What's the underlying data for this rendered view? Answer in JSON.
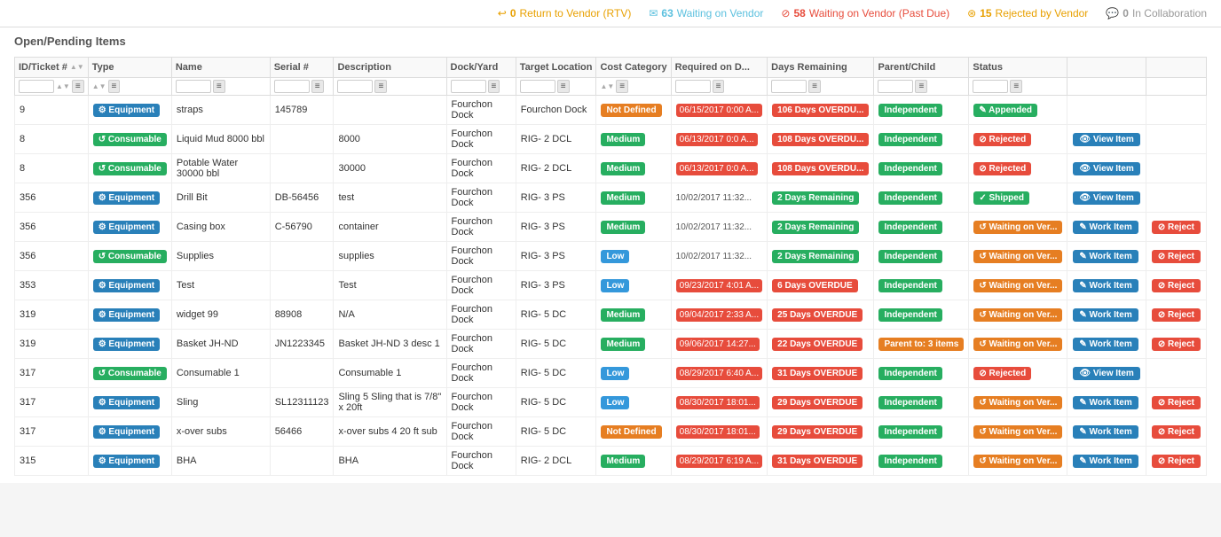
{
  "topbar": {
    "rtv_count": "0",
    "rtv_label": "Return to Vendor (RTV)",
    "waiting_count": "63",
    "waiting_label": "Waiting on Vendor",
    "pastdue_count": "58",
    "pastdue_label": "Waiting on Vendor (Past Due)",
    "rejected_count": "15",
    "rejected_label": "Rejected by Vendor",
    "collab_count": "0",
    "collab_label": "In Collaboration"
  },
  "section_title": "Open/Pending Items",
  "columns": [
    "ID/Ticket #",
    "Type",
    "Name",
    "Serial #",
    "Description",
    "Dock/Yard",
    "Target Location",
    "Cost Category",
    "Required on D...",
    "Days Remaining",
    "Parent/Child",
    "Status"
  ],
  "rows": [
    {
      "id": "9",
      "type": "Equipment",
      "type_class": "equipment",
      "name": "straps",
      "serial": "145789",
      "description": "",
      "dock": "Fourchon Dock",
      "target": "Fourchon Dock",
      "cost": "Not Defined",
      "cost_class": "not-defined",
      "required": "06/15/2017 0:00 A...",
      "required_class": "overdue",
      "days": "106 Days OVERDU...",
      "days_class": "overdue-days",
      "parent": "Independent",
      "parent_class": "independent",
      "status": "Appended",
      "status_class": "appended",
      "actions": []
    },
    {
      "id": "8",
      "type": "Consumable",
      "type_class": "consumable",
      "name": "Liquid Mud 8000 bbl",
      "serial": "",
      "description": "8000",
      "dock": "Fourchon Dock",
      "target": "RIG- 2 DCL",
      "cost": "Medium",
      "cost_class": "medium",
      "required": "06/13/2017 0:0 A...",
      "required_class": "overdue",
      "days": "108 Days OVERDU...",
      "days_class": "overdue-days",
      "parent": "Independent",
      "parent_class": "independent",
      "status": "Rejected",
      "status_class": "rejected",
      "actions": [
        "View Item"
      ]
    },
    {
      "id": "8",
      "type": "Consumable",
      "type_class": "consumable",
      "name": "Potable Water 30000 bbl",
      "serial": "",
      "description": "30000",
      "dock": "Fourchon Dock",
      "target": "RIG- 2 DCL",
      "cost": "Medium",
      "cost_class": "medium",
      "required": "06/13/2017 0:0 A...",
      "required_class": "overdue",
      "days": "108 Days OVERDU...",
      "days_class": "overdue-days",
      "parent": "Independent",
      "parent_class": "independent",
      "status": "Rejected",
      "status_class": "rejected",
      "actions": [
        "View Item"
      ]
    },
    {
      "id": "356",
      "type": "Equipment",
      "type_class": "equipment",
      "name": "Drill Bit",
      "serial": "DB-56456",
      "description": "test",
      "dock": "Fourchon Dock",
      "target": "RIG- 3 PS",
      "cost": "Medium",
      "cost_class": "medium",
      "required": "10/02/2017 11:32...",
      "required_class": "normal",
      "days": "2 Days Remaining",
      "days_class": "remaining",
      "parent": "Independent",
      "parent_class": "independent",
      "status": "Shipped",
      "status_class": "shipped",
      "actions": [
        "View Item"
      ]
    },
    {
      "id": "356",
      "type": "Equipment",
      "type_class": "equipment",
      "name": "Casing box",
      "serial": "C-56790",
      "description": "container",
      "dock": "Fourchon Dock",
      "target": "RIG- 3 PS",
      "cost": "Medium",
      "cost_class": "medium",
      "required": "10/02/2017 11:32...",
      "required_class": "normal",
      "days": "2 Days Remaining",
      "days_class": "remaining",
      "parent": "Independent",
      "parent_class": "independent",
      "status": "Waiting on Ver...",
      "status_class": "waiting",
      "actions": [
        "Work Item",
        "Reject"
      ]
    },
    {
      "id": "356",
      "type": "Consumable",
      "type_class": "consumable",
      "name": "Supplies",
      "serial": "",
      "description": "supplies",
      "dock": "Fourchon Dock",
      "target": "RIG- 3 PS",
      "cost": "Low",
      "cost_class": "low",
      "required": "10/02/2017 11:32...",
      "required_class": "normal",
      "days": "2 Days Remaining",
      "days_class": "remaining",
      "parent": "Independent",
      "parent_class": "independent",
      "status": "Waiting on Ver...",
      "status_class": "waiting",
      "actions": [
        "Work Item",
        "Reject"
      ]
    },
    {
      "id": "353",
      "type": "Equipment",
      "type_class": "equipment",
      "name": "Test",
      "serial": "",
      "description": "Test",
      "dock": "Fourchon Dock",
      "target": "RIG- 3 PS",
      "cost": "Low",
      "cost_class": "low",
      "required": "09/23/2017 4:01 A...",
      "required_class": "overdue",
      "days": "6 Days OVERDUE",
      "days_class": "overdue-days",
      "parent": "Independent",
      "parent_class": "independent",
      "status": "Waiting on Ver...",
      "status_class": "waiting",
      "actions": [
        "Work Item",
        "Reject"
      ]
    },
    {
      "id": "319",
      "type": "Equipment",
      "type_class": "equipment",
      "name": "widget 99",
      "serial": "88908",
      "description": "N/A",
      "dock": "Fourchon Dock",
      "target": "RIG- 5 DC",
      "cost": "Medium",
      "cost_class": "medium",
      "required": "09/04/2017 2:33 A...",
      "required_class": "overdue",
      "days": "25 Days OVERDUE",
      "days_class": "overdue-days",
      "parent": "Independent",
      "parent_class": "independent",
      "status": "Waiting on Ver...",
      "status_class": "waiting",
      "actions": [
        "Work Item",
        "Reject"
      ]
    },
    {
      "id": "319",
      "type": "Equipment",
      "type_class": "equipment",
      "name": "Basket JH-ND",
      "serial": "JN1223345",
      "description": "Basket JH-ND 3 desc 1",
      "dock": "Fourchon Dock",
      "target": "RIG- 5 DC",
      "cost": "Medium",
      "cost_class": "medium",
      "required": "09/06/2017 14:27...",
      "required_class": "overdue",
      "days": "22 Days OVERDUE",
      "days_class": "overdue-days",
      "parent": "Parent to: 3 items",
      "parent_class": "parent",
      "status": "Waiting on Ver...",
      "status_class": "waiting",
      "actions": [
        "Work Item",
        "Reject"
      ]
    },
    {
      "id": "317",
      "type": "Consumable",
      "type_class": "consumable",
      "name": "Consumable 1",
      "serial": "",
      "description": "Consumable 1",
      "dock": "Fourchon Dock",
      "target": "RIG- 5 DC",
      "cost": "Low",
      "cost_class": "low",
      "required": "08/29/2017 6:40 A...",
      "required_class": "overdue",
      "days": "31 Days OVERDUE",
      "days_class": "overdue-days",
      "parent": "Independent",
      "parent_class": "independent",
      "status": "Rejected",
      "status_class": "rejected",
      "actions": [
        "View Item"
      ]
    },
    {
      "id": "317",
      "type": "Equipment",
      "type_class": "equipment",
      "name": "Sling",
      "serial": "SL12311123",
      "description": "Sling 5 Sling that is 7/8\" x 20ft",
      "dock": "Fourchon Dock",
      "target": "RIG- 5 DC",
      "cost": "Low",
      "cost_class": "low",
      "required": "08/30/2017 18:01...",
      "required_class": "overdue",
      "days": "29 Days OVERDUE",
      "days_class": "overdue-days",
      "parent": "Independent",
      "parent_class": "independent",
      "status": "Waiting on Ver...",
      "status_class": "waiting",
      "actions": [
        "Work Item",
        "Reject"
      ]
    },
    {
      "id": "317",
      "type": "Equipment",
      "type_class": "equipment",
      "name": "x-over subs",
      "serial": "56466",
      "description": "x-over subs 4 20 ft sub",
      "dock": "Fourchon Dock",
      "target": "RIG- 5 DC",
      "cost": "Not Defined",
      "cost_class": "not-defined",
      "required": "08/30/2017 18:01...",
      "required_class": "overdue",
      "days": "29 Days OVERDUE",
      "days_class": "overdue-days",
      "parent": "Independent",
      "parent_class": "independent",
      "status": "Waiting on Ver...",
      "status_class": "waiting",
      "actions": [
        "Work Item",
        "Reject"
      ]
    },
    {
      "id": "315",
      "type": "Equipment",
      "type_class": "equipment",
      "name": "BHA",
      "serial": "",
      "description": "BHA",
      "dock": "Fourchon Dock",
      "target": "RIG- 2 DCL",
      "cost": "Medium",
      "cost_class": "medium",
      "required": "08/29/2017 6:19 A...",
      "required_class": "overdue",
      "days": "31 Days OVERDUE",
      "days_class": "overdue-days",
      "parent": "Independent",
      "parent_class": "independent",
      "status": "Waiting on Ver...",
      "status_class": "waiting",
      "actions": [
        "Work Item",
        "Reject"
      ]
    }
  ]
}
